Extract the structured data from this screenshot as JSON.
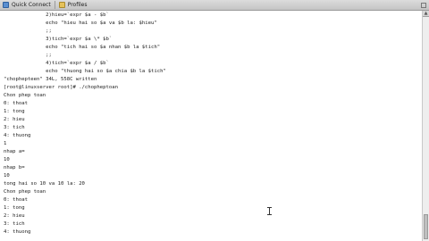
{
  "toolbar": {
    "quick_connect_label": "Quick Connect",
    "profiles_label": "Profiles"
  },
  "terminal": {
    "lines": [
      "              2)hieu=`expr $a - $b`",
      "              echo \"hieu hai so $a va $b la: $hieu\"",
      "              ;;",
      "              3)tich=`expr $a \\* $b`",
      "              echo \"tich hai so $a nhan $b la $tich\"",
      "              ;;",
      "              4)tich=`expr $a / $b`",
      "              echo \"thuong hai so $a chia $b la $tich\"",
      "\"chophepteen\" 34L, 558C written",
      "[root@linuxserver root]# ./chopheptoan",
      "Chon phep toan",
      "0: thoat",
      "1: tong",
      "2: hieu",
      "3: tich",
      "4: thuong",
      "1",
      "nhap a=",
      "10",
      "nhap b=",
      "10",
      "tong hai so 10 va 10 la: 20",
      "Chon phep toan",
      "0: thoat",
      "1: tong",
      "2: hieu",
      "3: tich",
      "4: thuong"
    ]
  },
  "colors": {
    "terminal_background": "#ffffff",
    "terminal_text": "#222222",
    "toolbar_background": "#d0d0d0"
  },
  "icons": {
    "quick_connect": "quick-connect-icon",
    "profiles": "profiles-folder-icon"
  }
}
